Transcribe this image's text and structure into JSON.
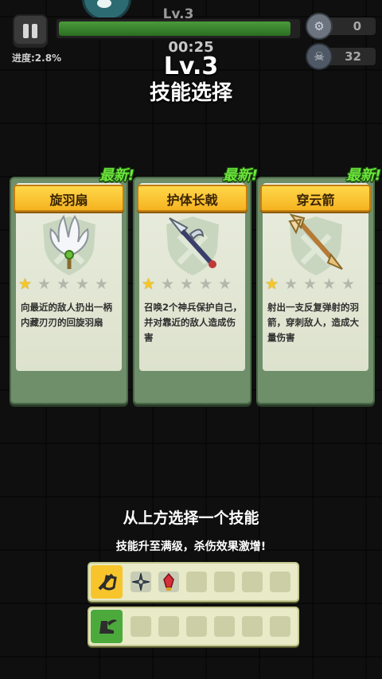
{
  "hud": {
    "progress_label": "进度:2.8%",
    "level_label": "Lv.3",
    "xp_fill_fraction": 0.97,
    "timer": "00:25",
    "coin_icon": "gear-coin-icon",
    "coin_count": "0",
    "kill_icon": "skull-icon",
    "kill_count": "32"
  },
  "level_title": "Lv.3",
  "choose_title": "技能选择",
  "cards": [
    {
      "new_label": "最新!",
      "title": "旋羽扇",
      "icon": "feather-fan-icon",
      "stars_filled": 1,
      "stars_total": 5,
      "desc": "向最近的敌人扔出一柄内藏刃刃的回旋羽扇"
    },
    {
      "new_label": "最新!",
      "title": "护体长戟",
      "icon": "halberd-icon",
      "stars_filled": 1,
      "stars_total": 5,
      "desc": "召唤2个神兵保护自己，并对靠近的敌人造成伤害"
    },
    {
      "new_label": "最新!",
      "title": "穿云箭",
      "icon": "arrow-icon",
      "stars_filled": 1,
      "stars_total": 5,
      "desc": "射出一支反复弹射的羽箭，穿刺敌人，造成大量伤害"
    }
  ],
  "hint_main": "从上方选择一个技能",
  "hint_sub": "技能升至满级，杀伤效果激增!",
  "slot_rows": [
    {
      "badge_icon": "sword-shield-icon",
      "filled": [
        "shuriken-icon",
        "red-crystal-icon"
      ],
      "total": 6
    },
    {
      "badge_icon": "winged-boot-icon",
      "filled": [],
      "total": 6
    }
  ],
  "colors": {
    "banner": "#f5b320",
    "new_text": "#6be63a",
    "star_on": "#f6c726",
    "card_frame": "#6f8f6b",
    "xp_fill": "#2b6e22"
  }
}
